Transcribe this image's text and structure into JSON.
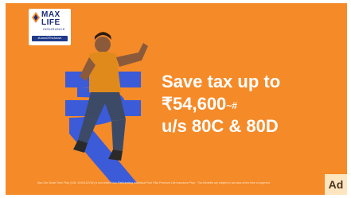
{
  "ad": {
    "logo": {
      "brand_line1": "MAX",
      "brand_line2": "LIFE",
      "brand_line3": "INSURANCE",
      "tagline": "#LawsOfTheAbove"
    },
    "headline": {
      "line1": "Save tax up to",
      "line2_amount": "₹54,600",
      "line2_sup": "~#",
      "line3": "u/s 80C & 80D"
    },
    "disclaimer": "Max Life Smart Term Plan (UIN: 104N113V04) is non-linked Non-Participating Individual Pure Risk Premium Life Insurance Plan. ~Tax Benefits are subject to tax laws at the time of payment.",
    "badge": "Ad"
  },
  "colors": {
    "background": "#f58a28",
    "rupee_symbol": "#3b5bd9",
    "text": "#ffffff"
  }
}
